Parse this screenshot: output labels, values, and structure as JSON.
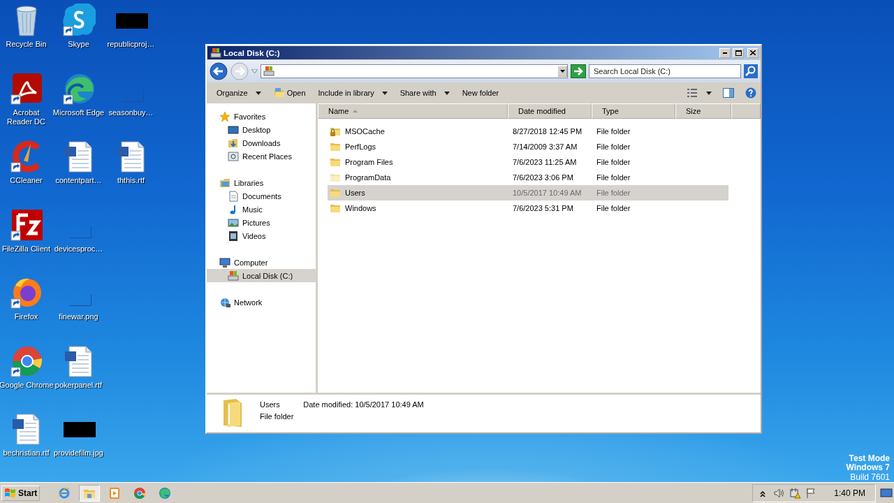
{
  "desktop": {
    "icons": [
      {
        "label": "Recycle Bin",
        "kind": "recycle-bin",
        "shortcut": false
      },
      {
        "label": "Acrobat Reader DC",
        "kind": "acrobat",
        "shortcut": true
      },
      {
        "label": "CCleaner",
        "kind": "ccleaner",
        "shortcut": true
      },
      {
        "label": "FileZilla Client",
        "kind": "filezilla",
        "shortcut": true
      },
      {
        "label": "Firefox",
        "kind": "firefox",
        "shortcut": true
      },
      {
        "label": "Google Chrome",
        "kind": "chrome",
        "shortcut": true
      },
      {
        "label": "bechristian.rtf",
        "kind": "document",
        "shortcut": false
      },
      {
        "label": "Skype",
        "kind": "skype",
        "shortcut": true
      },
      {
        "label": "Microsoft Edge",
        "kind": "edge",
        "shortcut": true
      },
      {
        "label": "contentpart…",
        "kind": "document",
        "shortcut": false
      },
      {
        "label": "devicesproc…",
        "kind": "blank",
        "shortcut": false
      },
      {
        "label": "finewar.png",
        "kind": "blank",
        "shortcut": false
      },
      {
        "label": "pokerpanel.rtf",
        "kind": "document",
        "shortcut": false
      },
      {
        "label": "providefilm.jpg",
        "kind": "dark-image",
        "shortcut": false
      },
      {
        "label": "republicproj…",
        "kind": "dark-image",
        "shortcut": false
      },
      {
        "label": "seasonbuy…",
        "kind": "blank",
        "shortcut": false
      },
      {
        "label": "ththis.rtf",
        "kind": "document",
        "shortcut": false
      }
    ],
    "system_text": [
      "Test Mode",
      "Windows 7",
      "Build 7601"
    ]
  },
  "window": {
    "title": "Local Disk (C:)",
    "search": {
      "placeholder": "Search Local Disk (C:)"
    },
    "toolbar": [
      {
        "label": "Organize",
        "kind": "menu"
      },
      {
        "label": "Open",
        "kind": "open"
      },
      {
        "label": "Include in library",
        "kind": "menu"
      },
      {
        "label": "Share with",
        "kind": "menu"
      },
      {
        "label": "New folder",
        "kind": "plain"
      }
    ],
    "nav": [
      {
        "label": "Favorites",
        "kind": "star",
        "selected": false,
        "children": [
          {
            "label": "Desktop",
            "kind": "desktop",
            "selected": false
          },
          {
            "label": "Downloads",
            "kind": "downloads",
            "selected": false
          },
          {
            "label": "Recent Places",
            "kind": "recent",
            "selected": false
          }
        ]
      },
      {
        "label": "Libraries",
        "kind": "library",
        "selected": false,
        "children": [
          {
            "label": "Documents",
            "kind": "documents",
            "selected": false
          },
          {
            "label": "Music",
            "kind": "music",
            "selected": false
          },
          {
            "label": "Pictures",
            "kind": "pictures",
            "selected": false
          },
          {
            "label": "Videos",
            "kind": "videos",
            "selected": false
          }
        ]
      },
      {
        "label": "Computer",
        "kind": "computer",
        "selected": false,
        "children": [
          {
            "label": "Local Disk (C:)",
            "kind": "drive",
            "selected": true
          }
        ]
      },
      {
        "label": "Network",
        "kind": "network",
        "selected": false
      }
    ],
    "columns": [
      {
        "label": "Name",
        "sorted": true
      },
      {
        "label": "Date modified",
        "sorted": false
      },
      {
        "label": "Type",
        "sorted": false
      },
      {
        "label": "Size",
        "sorted": false
      }
    ],
    "rows": [
      {
        "name": "MSOCache",
        "date": "8/27/2018 12:45 PM",
        "type": "File folder",
        "kind": "locked-folder",
        "hidden": false,
        "selected": false
      },
      {
        "name": "PerfLogs",
        "date": "7/14/2009 3:37 AM",
        "type": "File folder",
        "kind": "folder",
        "hidden": false,
        "selected": false
      },
      {
        "name": "Program Files",
        "date": "7/6/2023 11:25 AM",
        "type": "File folder",
        "kind": "folder",
        "hidden": false,
        "selected": false
      },
      {
        "name": "ProgramData",
        "date": "7/6/2023 3:06 PM",
        "type": "File folder",
        "kind": "folder",
        "hidden": true,
        "selected": false
      },
      {
        "name": "Users",
        "date": "10/5/2017 10:49 AM",
        "type": "File folder",
        "kind": "folder",
        "hidden": false,
        "selected": true
      },
      {
        "name": "Windows",
        "date": "7/6/2023 5:31 PM",
        "type": "File folder",
        "kind": "folder",
        "hidden": false,
        "selected": false
      }
    ],
    "details": {
      "name": "Users",
      "modified": "Date modified: 10/5/2017 10:49 AM",
      "type": "File folder"
    }
  },
  "taskbar": {
    "start": "Start",
    "apps": [
      {
        "kind": "ie",
        "active": false
      },
      {
        "kind": "explorer",
        "active": true
      },
      {
        "kind": "media",
        "active": false
      },
      {
        "kind": "chrome",
        "active": false
      },
      {
        "kind": "edge",
        "active": false
      }
    ],
    "tray": [
      {
        "kind": "chevron"
      },
      {
        "kind": "speaker"
      },
      {
        "kind": "network-warning"
      },
      {
        "kind": "flag"
      }
    ],
    "clock": "1:40 PM"
  }
}
